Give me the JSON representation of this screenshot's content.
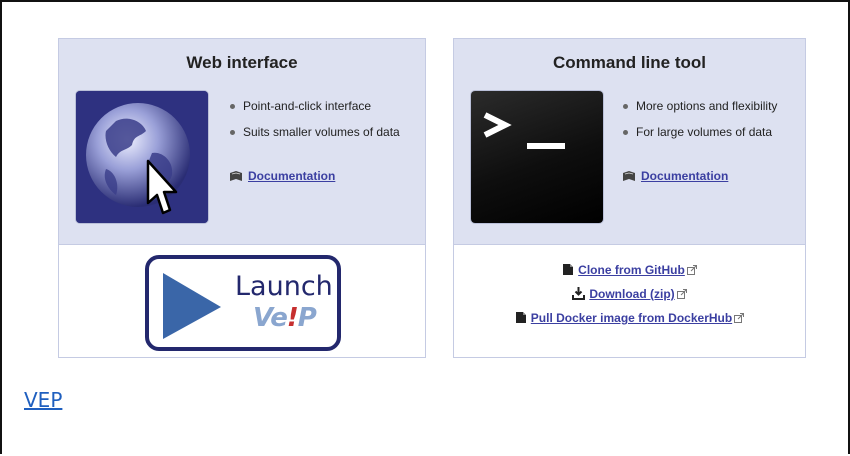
{
  "web_panel": {
    "title": "Web interface",
    "thumb_icon": "globe-cursor-icon",
    "bullets": [
      "Point-and-click interface",
      "Suits smaller volumes of data"
    ],
    "doc_label": "Documentation",
    "launch": {
      "word": "Launch",
      "brand_a": "Ve",
      "brand_bang": "!",
      "brand_b": "P"
    }
  },
  "cli_panel": {
    "title": "Command line tool",
    "thumb_icon": "terminal-icon",
    "bullets": [
      "More options and flexibility",
      "For large volumes of data"
    ],
    "doc_label": "Documentation",
    "links": [
      {
        "label": "Clone from GitHub",
        "icon": "file-icon"
      },
      {
        "label": "Download (zip)",
        "icon": "download-icon"
      },
      {
        "label": "Pull Docker image from DockerHub",
        "icon": "file-icon"
      }
    ]
  },
  "footer_link": "VEP",
  "colors": {
    "panel_bg": "#dde1f1",
    "link": "#3b3fa1",
    "brand_navy": "#23286d",
    "footer_link": "#1f5fbf"
  }
}
